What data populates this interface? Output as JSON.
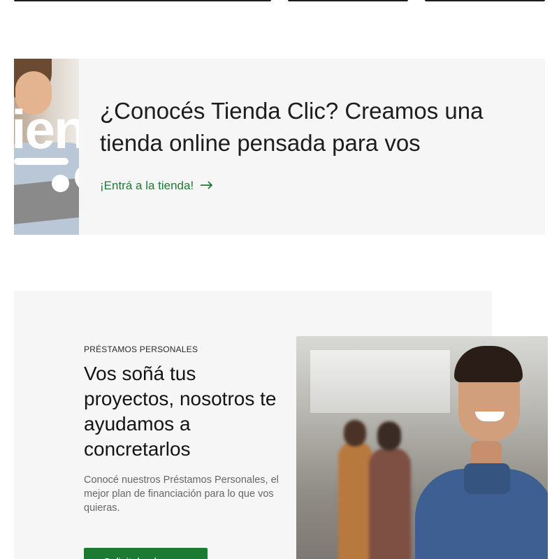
{
  "tienda_banner": {
    "title": "¿Conocés Tienda Clic? Creamos una tienda online pensada para vos",
    "link_label": "¡Entrá a la tienda!",
    "image_text": "ien",
    "accent_color": "#1d7a33"
  },
  "prestamos": {
    "eyebrow": "PRÉSTAMOS PERSONALES",
    "title": "Vos soñá tus proyectos, nosotros te ayudamos a concretarlos",
    "description": "Conocé nuestros Préstamos Personales, el mejor plan de financiación para lo que vos quieras.",
    "button_label": "Solicitalo ahora",
    "button_color": "#1d7a33"
  }
}
